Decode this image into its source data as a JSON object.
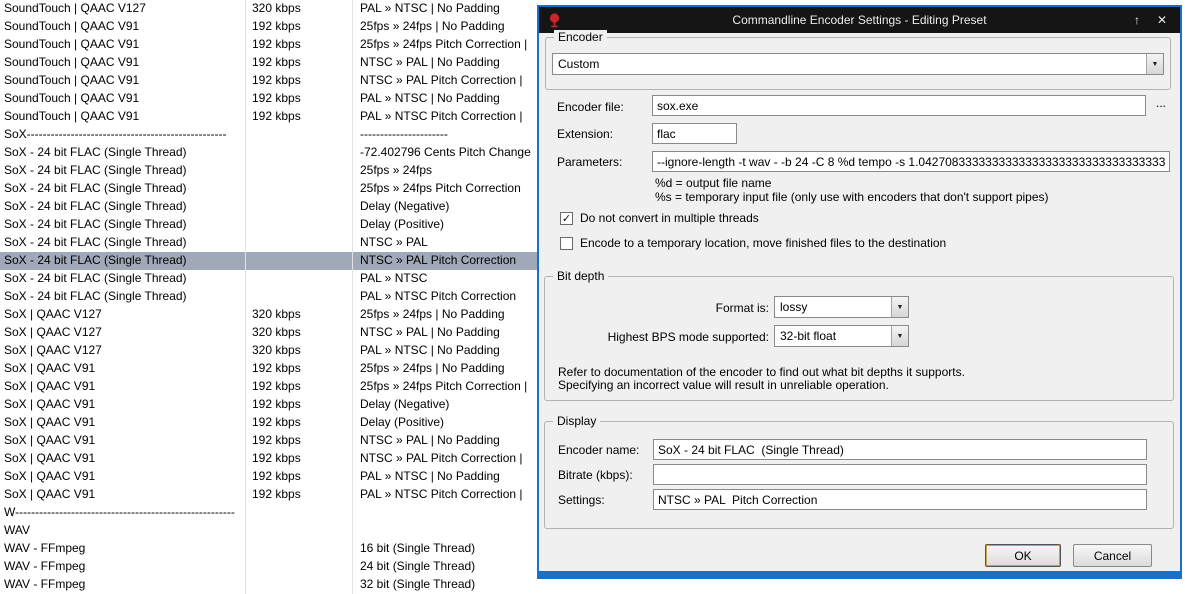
{
  "icons": {
    "dropdown_arrow": "▼",
    "rollup_arrow": "↑",
    "close": "✕",
    "check": "✓"
  },
  "colors": {
    "accent_border_blue": "#1670cc",
    "titlebar_black": "#151515",
    "selection_gray_blue": "#9fa9b7",
    "app_icon_red": "#c9252b"
  },
  "preset_list": {
    "rows": [
      {
        "name": "SoundTouch | QAAC  V127",
        "bitrate": "320 kbps",
        "settings": "PAL » NTSC  |  No Padding"
      },
      {
        "name": "SoundTouch | QAAC  V91",
        "bitrate": "192 kbps",
        "settings": "25fps » 24fps  |  No Padding"
      },
      {
        "name": "SoundTouch | QAAC  V91",
        "bitrate": "192 kbps",
        "settings": "25fps » 24fps  Pitch Correction  |"
      },
      {
        "name": "SoundTouch | QAAC  V91",
        "bitrate": "192 kbps",
        "settings": "NTSC » PAL  |  No Padding"
      },
      {
        "name": "SoundTouch | QAAC  V91",
        "bitrate": "192 kbps",
        "settings": "NTSC » PAL  Pitch Correction  |"
      },
      {
        "name": "SoundTouch | QAAC  V91",
        "bitrate": "192 kbps",
        "settings": "PAL » NTSC  |  No Padding"
      },
      {
        "name": "SoundTouch | QAAC  V91",
        "bitrate": "192 kbps",
        "settings": "PAL » NTSC  Pitch Correction  |"
      },
      {
        "name": "SoX--------------------------------------------------",
        "bitrate": "",
        "settings": "----------------------"
      },
      {
        "name": "SoX - 24 bit FLAC  (Single Thread)",
        "bitrate": "",
        "settings": "-72.402796 Cents  Pitch Change"
      },
      {
        "name": "SoX - 24 bit FLAC  (Single Thread)",
        "bitrate": "",
        "settings": "25fps » 24fps"
      },
      {
        "name": "SoX - 24 bit FLAC  (Single Thread)",
        "bitrate": "",
        "settings": "25fps » 24fps  Pitch Correction"
      },
      {
        "name": "SoX - 24 bit FLAC  (Single Thread)",
        "bitrate": "",
        "settings": "Delay (Negative)"
      },
      {
        "name": "SoX - 24 bit FLAC  (Single Thread)",
        "bitrate": "",
        "settings": "Delay (Positive)"
      },
      {
        "name": "SoX - 24 bit FLAC  (Single Thread)",
        "bitrate": "",
        "settings": "NTSC » PAL"
      },
      {
        "name": "SoX - 24 bit FLAC  (Single Thread)",
        "bitrate": "",
        "settings": "NTSC » PAL  Pitch Correction",
        "selected": true
      },
      {
        "name": "SoX - 24 bit FLAC  (Single Thread)",
        "bitrate": "",
        "settings": "PAL » NTSC"
      },
      {
        "name": "SoX - 24 bit FLAC  (Single Thread)",
        "bitrate": "",
        "settings": "PAL » NTSC  Pitch Correction"
      },
      {
        "name": "SoX | QAAC  V127",
        "bitrate": "320 kbps",
        "settings": "25fps » 24fps  |  No Padding"
      },
      {
        "name": "SoX | QAAC  V127",
        "bitrate": "320 kbps",
        "settings": "NTSC » PAL  |  No Padding"
      },
      {
        "name": "SoX | QAAC  V127",
        "bitrate": "320 kbps",
        "settings": "PAL » NTSC  |  No Padding"
      },
      {
        "name": "SoX | QAAC  V91",
        "bitrate": "192 kbps",
        "settings": "25fps » 24fps  |  No Padding"
      },
      {
        "name": "SoX | QAAC  V91",
        "bitrate": "192 kbps",
        "settings": "25fps » 24fps  Pitch Correction  |"
      },
      {
        "name": "SoX | QAAC  V91",
        "bitrate": "192 kbps",
        "settings": "Delay (Negative)"
      },
      {
        "name": "SoX | QAAC  V91",
        "bitrate": "192 kbps",
        "settings": "Delay (Positive)"
      },
      {
        "name": "SoX | QAAC  V91",
        "bitrate": "192 kbps",
        "settings": "NTSC » PAL  |  No Padding"
      },
      {
        "name": "SoX | QAAC  V91",
        "bitrate": "192 kbps",
        "settings": "NTSC » PAL  Pitch Correction  |"
      },
      {
        "name": "SoX | QAAC  V91",
        "bitrate": "192 kbps",
        "settings": "PAL » NTSC  |  No Padding"
      },
      {
        "name": "SoX | QAAC  V91",
        "bitrate": "192 kbps",
        "settings": "PAL » NTSC  Pitch Correction  |"
      },
      {
        "name": "W-------------------------------------------------------",
        "bitrate": "",
        "settings": ""
      },
      {
        "name": "WAV",
        "bitrate": "",
        "settings": ""
      },
      {
        "name": "WAV - FFmpeg",
        "bitrate": "",
        "settings": "16 bit  (Single Thread)"
      },
      {
        "name": "WAV - FFmpeg",
        "bitrate": "",
        "settings": "24 bit  (Single Thread)"
      },
      {
        "name": "WAV - FFmpeg",
        "bitrate": "",
        "settings": "32 bit  (Single Thread)"
      }
    ]
  },
  "dialog": {
    "title": "Commandline Encoder Settings - Editing Preset",
    "encoder_group": {
      "label": "Encoder",
      "selected_encoder": "Custom"
    },
    "file_section": {
      "encoder_file_label": "Encoder file:",
      "encoder_file_value": "sox.exe",
      "browse_label": "...",
      "extension_label": "Extension:",
      "extension_value": "flac",
      "parameters_label": "Parameters:",
      "parameters_value": "--ignore-length -t wav - -b 24 -C 8 %d tempo -s 1.042708333333333333333333333333333333333333",
      "help_output": "%d = output file name",
      "help_temp": "%s = temporary input file  (only use with encoders that don't support pipes)",
      "multithread_label": "Do not convert in multiple threads",
      "multithread_checked": true,
      "templocation_label": "Encode to a temporary location, move finished files to the destination",
      "templocation_checked": false
    },
    "bit_depth_group": {
      "label": "Bit depth",
      "format_label": "Format is:",
      "format_value": "lossy",
      "bps_label": "Highest BPS mode supported:",
      "bps_value": "32-bit float",
      "note1": "Refer to documentation of the encoder to find out what bit depths it supports.",
      "note2": "Specifying an incorrect value will result in unreliable operation."
    },
    "display_group": {
      "label": "Display",
      "encoder_name_label": "Encoder name:",
      "encoder_name_value": "SoX - 24 bit FLAC  (Single Thread)",
      "bitrate_label": "Bitrate (kbps):",
      "bitrate_value": "",
      "settings_label": "Settings:",
      "settings_value": "NTSC » PAL  Pitch Correction"
    },
    "buttons": {
      "ok": "OK",
      "cancel": "Cancel"
    }
  }
}
